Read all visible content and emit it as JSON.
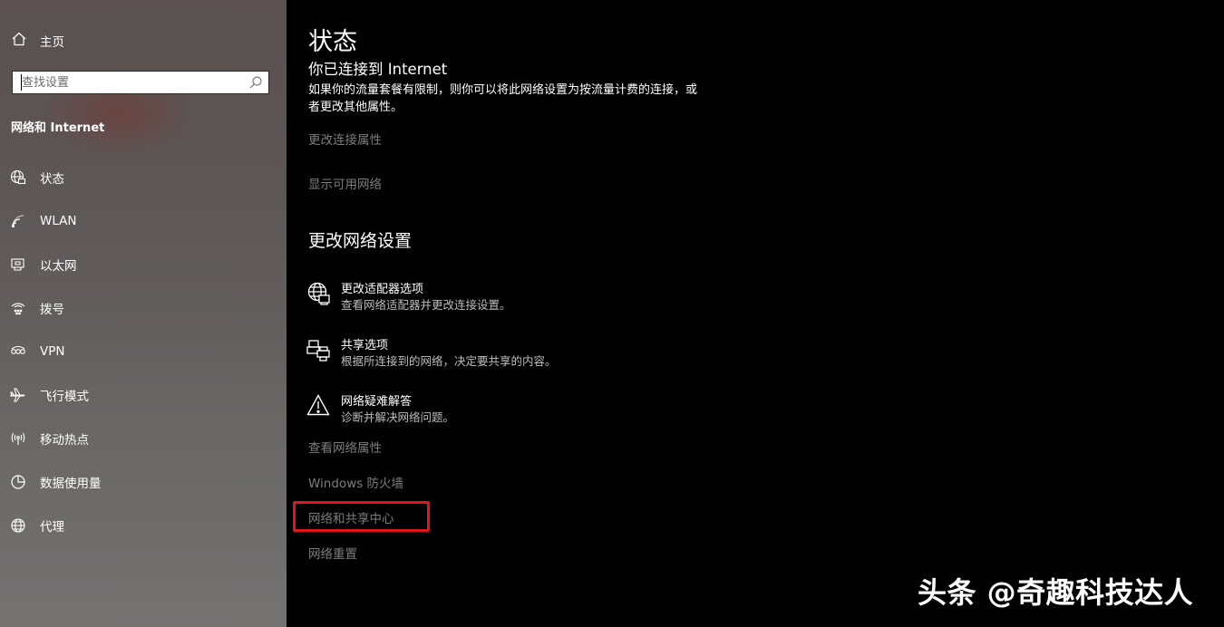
{
  "sidebar": {
    "home": {
      "label": "主页",
      "icon": "home-icon"
    },
    "search": {
      "placeholder": "查找设置",
      "icon": "search-icon"
    },
    "section_title": "网络和 Internet",
    "items": [
      {
        "label": "状态",
        "icon": "status-globe-icon"
      },
      {
        "label": "WLAN",
        "icon": "wifi-icon"
      },
      {
        "label": "以太网",
        "icon": "ethernet-icon"
      },
      {
        "label": "拨号",
        "icon": "dialup-icon"
      },
      {
        "label": "VPN",
        "icon": "vpn-icon"
      },
      {
        "label": "飞行模式",
        "icon": "airplane-icon"
      },
      {
        "label": "移动热点",
        "icon": "hotspot-icon"
      },
      {
        "label": "数据使用量",
        "icon": "data-usage-icon"
      },
      {
        "label": "代理",
        "icon": "proxy-globe-icon"
      }
    ]
  },
  "main": {
    "title": "状态",
    "subtitle": "你已连接到 Internet",
    "description": "如果你的流量套餐有限制，则你可以将此网络设置为按流量计费的连接，或者更改其他属性。",
    "links_top": [
      "更改连接属性",
      "显示可用网络"
    ],
    "section_heading": "更改网络设置",
    "options": [
      {
        "title": "更改适配器选项",
        "description": "查看网络适配器并更改连接设置。",
        "icon": "adapter-globe-icon"
      },
      {
        "title": "共享选项",
        "description": "根据所连接到的网络，决定要共享的内容。",
        "icon": "sharing-printer-icon"
      },
      {
        "title": "网络疑难解答",
        "description": "诊断并解决网络问题。",
        "icon": "warning-triangle-icon"
      }
    ],
    "links_bottom": [
      "查看网络属性",
      "Windows 防火墙",
      "网络和共享中心",
      "网络重置"
    ]
  },
  "watermark": "头条 @奇趣科技达人",
  "colors": {
    "highlight": "#e0161b",
    "link": "#7d7d7d",
    "background": "#000000"
  }
}
